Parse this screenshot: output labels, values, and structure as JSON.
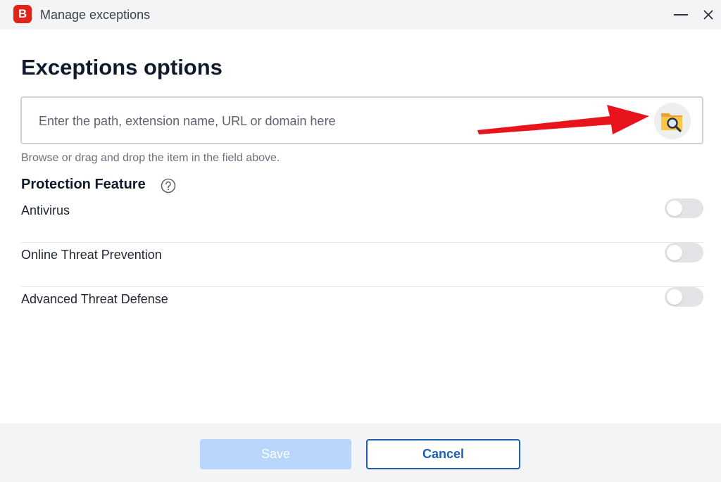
{
  "window": {
    "app_logo": "B",
    "title": "Manage exceptions"
  },
  "page": {
    "title": "Exceptions options"
  },
  "path_field": {
    "placeholder": "Enter the path, extension name, URL or domain here",
    "value": "",
    "browse_icon": "folder-search-icon"
  },
  "helper_text": "Browse or drag and drop the item in the field above.",
  "protection": {
    "title": "Protection Feature",
    "features": [
      {
        "label": "Antivirus",
        "enabled": false
      },
      {
        "label": "Online Threat Prevention",
        "enabled": false
      },
      {
        "label": "Advanced Threat Defense",
        "enabled": false
      }
    ]
  },
  "footer": {
    "save_label": "Save",
    "cancel_label": "Cancel"
  },
  "colors": {
    "brand": "#e2231a",
    "accent": "#1a5fb4",
    "save_disabled": "#b8d5fb",
    "annotation_arrow": "#e8141b"
  }
}
